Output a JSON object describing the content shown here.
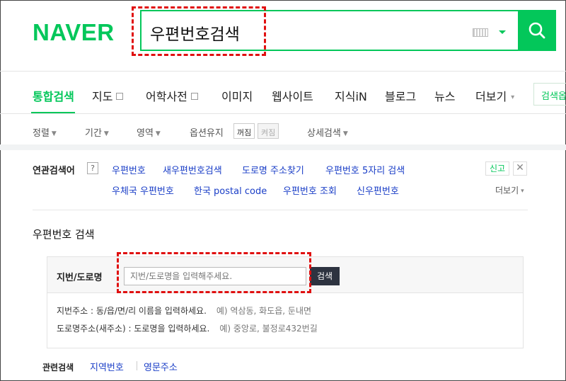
{
  "header": {
    "logo": "NAVER",
    "query": "우편번호검색"
  },
  "tabs": [
    {
      "label": "통합검색",
      "active": true
    },
    {
      "label": "지도"
    },
    {
      "label": "어학사전"
    },
    {
      "label": "이미지"
    },
    {
      "label": "웹사이트"
    },
    {
      "label": "지식iN"
    },
    {
      "label": "블로그"
    },
    {
      "label": "뉴스"
    },
    {
      "label": "더보기"
    }
  ],
  "side_button": "검색옵",
  "options": {
    "sort": "정렬",
    "period": "기간",
    "area": "영역",
    "keep_option": "옵션유지",
    "toggle_off": "꺼짐",
    "toggle_on": "켜짐",
    "detail_search": "상세검색"
  },
  "related": {
    "title": "연관검색어",
    "help": "?",
    "report": "신고",
    "more": "더보기",
    "row1": [
      "우편번호",
      "새우편번호검색",
      "도로명 주소찾기",
      "우편번호 5자리 검색"
    ],
    "row2": [
      "우체국 우편번호",
      "한국 postal code",
      "우편번호 조회",
      "신우편번호"
    ]
  },
  "postal": {
    "title": "우편번호 검색",
    "field_label": "지번/도로명",
    "placeholder": "지번/도로명을 입력해주세요.",
    "button": "검색",
    "hint1": "지번주소 : 동/읍/면/리 이름을 입력하세요.",
    "hint1_example": "예) 역삼동, 화도읍, 둔내면",
    "hint2": "도로명주소(새주소) : 도로명을 입력하세요.",
    "hint2_example": "예) 중앙로, 불정로432번길"
  },
  "footer": {
    "title": "관련검색",
    "links": [
      "지역번호",
      "영문주소"
    ]
  },
  "colors": {
    "brand_green": "#03c75a",
    "link_blue": "#1a3ec7",
    "annotation_red": "#e01010"
  }
}
